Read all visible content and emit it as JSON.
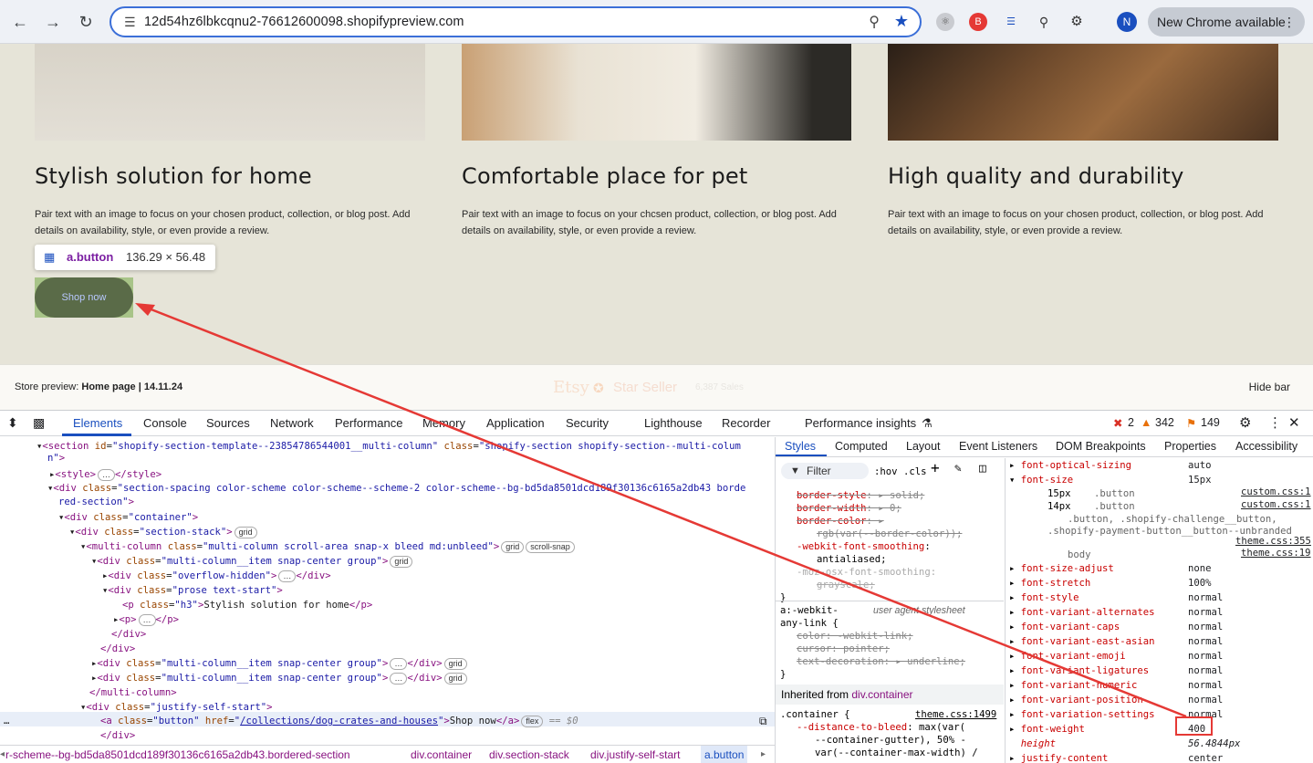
{
  "browser": {
    "url": "12d54hz6lbkcqnu2-76612600098.shopifypreview.com",
    "profile_initial": "N",
    "update_label": "New Chrome available",
    "icons": [
      "back-icon",
      "forward-icon",
      "reload-icon",
      "tune-icon",
      "zoom-icon",
      "star-icon",
      "extensions-icon",
      "menu-icon"
    ]
  },
  "page": {
    "cards": [
      {
        "title": "Stylish solution for home",
        "text": "Pair text with an image to focus on your chosen product, collection, or blog post. Add details on availability, style, or even provide a review."
      },
      {
        "title": "Comfortable place for pet",
        "text": "Pair text with an image to focus on your chcsen product, collection, or blog post. Add details on availability, style, or even provide a review."
      },
      {
        "title": "High quality and durability",
        "text": "Pair text with an image to focus on your chosen product, collection, or blog post. Add details on availability, style, or even provide a review."
      }
    ],
    "tooltip": {
      "tag": "a.button",
      "dims": "136.29 × 56.48"
    },
    "button_label": "Shop now",
    "button_color": "#5a6b48"
  },
  "previewbar": {
    "label_prefix": "Store preview: ",
    "label_page": "Home page | 14.11.24",
    "etsy": "Etsy",
    "seller": "Star Seller",
    "sales": "6,387 Sales",
    "hide": "Hide bar"
  },
  "devtools": {
    "tabs": [
      "Elements",
      "Console",
      "Sources",
      "Network",
      "Performance",
      "Memory",
      "Application",
      "Security",
      "Lighthouse",
      "Recorder",
      "Performance insights"
    ],
    "errors": "2",
    "warnings": "342",
    "issues": "149",
    "subtabs": [
      "Styles",
      "Computed",
      "Layout",
      "Event Listeners",
      "DOM Breakpoints",
      "Properties",
      "Accessibility"
    ],
    "filter_placeholder": "Filter",
    "hov": ":hov",
    "cls": ".cls",
    "dom": {
      "l1": "shopify-section-template--23854786544001__multi-column",
      "l1b": "shopify-section shopify-section--multi-colum",
      "l3": "section-spacing color-scheme color-scheme--scheme-2 color-scheme--bg-bd5da8501dcd189f30136c6165a2db43 borde",
      "l3b": "red-section",
      "l11": "Stylish solution for home",
      "href": "/collections/dog-crates-and-houses",
      "shop": "Shop now"
    },
    "crumbs": [
      "r-scheme--bg-bd5da8501dcd189f30136c6165a2db43.bordered-section",
      "div.container",
      "div.section-stack",
      "div.justify-self-start",
      "a.button"
    ],
    "computed": [
      {
        "name": "font-optical-sizing",
        "val": "auto"
      },
      {
        "name": "font-size",
        "val": "15px"
      },
      {
        "name": "font-size-adjust",
        "val": "none"
      },
      {
        "name": "font-stretch",
        "val": "100%"
      },
      {
        "name": "font-style",
        "val": "normal"
      },
      {
        "name": "font-variant-alternates",
        "val": "normal"
      },
      {
        "name": "font-variant-caps",
        "val": "normal"
      },
      {
        "name": "font-variant-east-asian",
        "val": "normal"
      },
      {
        "name": "font-variant-emoji",
        "val": "normal"
      },
      {
        "name": "font-variant-ligatures",
        "val": "normal"
      },
      {
        "name": "font-variant-numeric",
        "val": "normal"
      },
      {
        "name": "font-variant-position",
        "val": "normal"
      },
      {
        "name": "font-variation-settings",
        "val": "normal"
      },
      {
        "name": "font-weight",
        "val": "400"
      },
      {
        "name": "height",
        "val": "56.4844px"
      },
      {
        "name": "justify-content",
        "val": "center"
      }
    ]
  }
}
